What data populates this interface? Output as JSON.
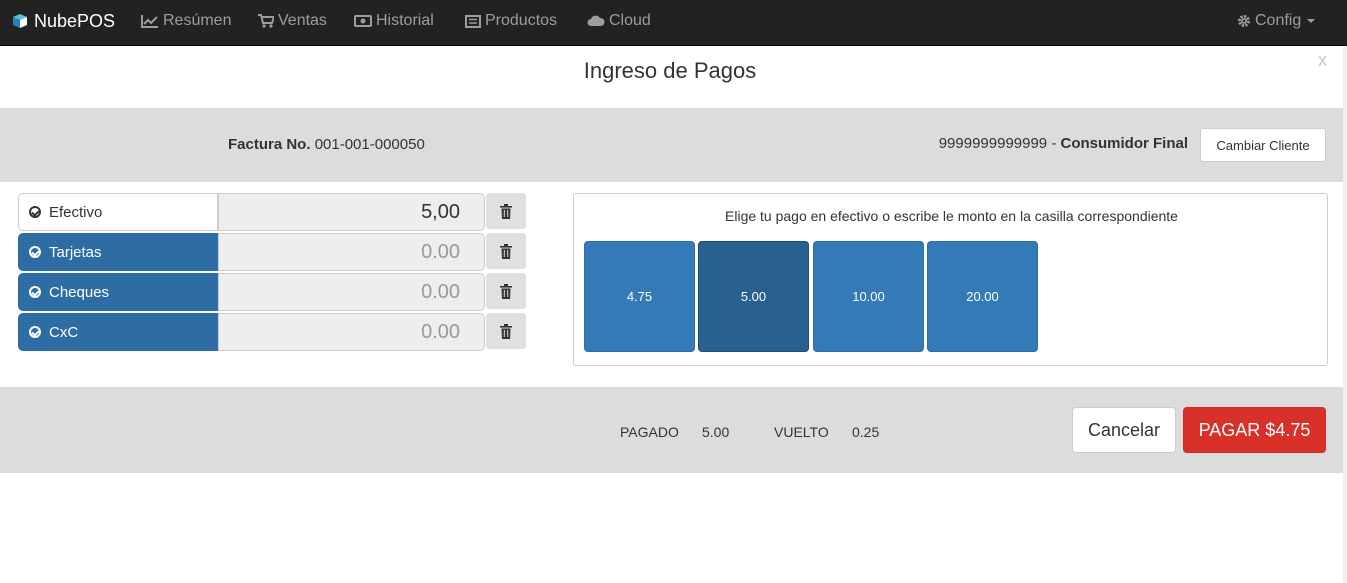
{
  "navbar": {
    "brand": "NubePOS",
    "items": [
      {
        "label": "Resúmen",
        "icon": "line-chart-icon"
      },
      {
        "label": "Ventas",
        "icon": "shopping-cart-icon"
      },
      {
        "label": "Historial",
        "icon": "money-icon"
      },
      {
        "label": "Productos",
        "icon": "list-icon"
      },
      {
        "label": "Cloud",
        "icon": "cloud-icon"
      }
    ],
    "config_label": "Config",
    "colors": {
      "background": "#222222",
      "text": "#9d9d9d",
      "brand": "#ffffff"
    }
  },
  "modal": {
    "title": "Ingreso de Pagos",
    "close": "x"
  },
  "invoice": {
    "label": "Factura No.",
    "number": "001-001-000050"
  },
  "client": {
    "id": "9999999999999",
    "separator": " - ",
    "name": "Consumidor Final",
    "change_button": "Cambiar Cliente"
  },
  "payments": [
    {
      "label": "Efectivo",
      "value": "5,00",
      "active": true
    },
    {
      "label": "Tarjetas",
      "value": "0.00",
      "active": false
    },
    {
      "label": "Cheques",
      "value": "0.00",
      "active": false
    },
    {
      "label": "CxC",
      "value": "0.00",
      "active": false
    }
  ],
  "cash": {
    "hint": "Elige tu pago en efectivo o escribe le monto en la casilla correspondiente",
    "options": [
      "4.75",
      "5.00",
      "10.00",
      "20.00"
    ],
    "selected": "5.00"
  },
  "summary": {
    "paid_label": "PAGADO",
    "paid_value": "5.00",
    "change_label": "VUELTO",
    "change_value": "0.25"
  },
  "actions": {
    "cancel": "Cancelar",
    "pay": "PAGAR $4.75"
  },
  "colors": {
    "primary": "#337ab7",
    "primary_dark": "#286090",
    "danger": "#d9302a",
    "bar_gray": "#dcdcdc"
  }
}
